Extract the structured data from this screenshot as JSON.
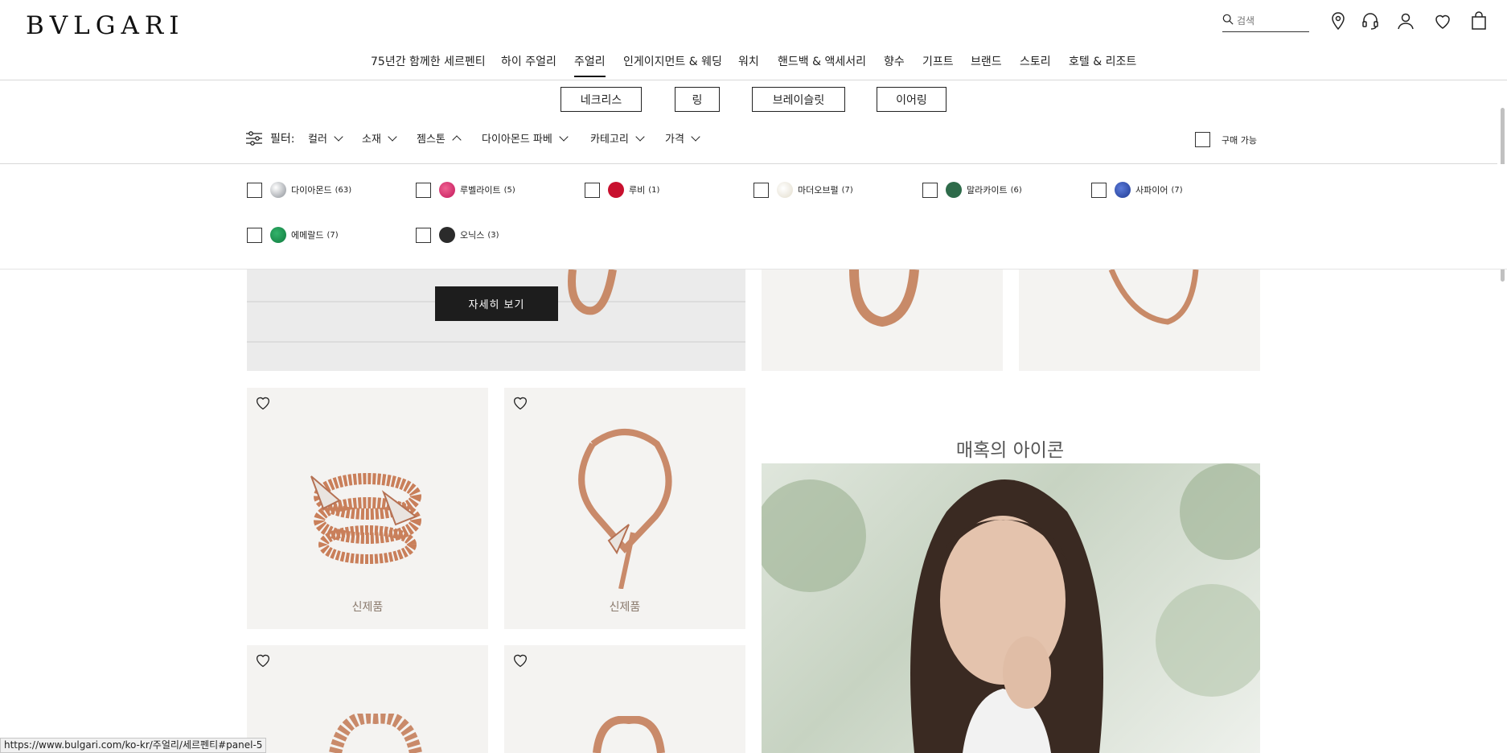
{
  "header": {
    "logo": "BVLGARI",
    "search_placeholder": "검색",
    "icons": [
      "search-icon",
      "location-pin-icon",
      "headset-icon",
      "user-icon",
      "heart-icon",
      "shopping-bag-icon"
    ]
  },
  "main_nav": [
    {
      "label": "75년간 함께한 세르펜티",
      "active": false
    },
    {
      "label": "하이 주얼리",
      "active": false
    },
    {
      "label": "주얼리",
      "active": true
    },
    {
      "label": "인게이지먼트 & 웨딩",
      "active": false
    },
    {
      "label": "워치",
      "active": false
    },
    {
      "label": "핸드백 & 액세서리",
      "active": false
    },
    {
      "label": "향수",
      "active": false
    },
    {
      "label": "기프트",
      "active": false
    },
    {
      "label": "브랜드",
      "active": false
    },
    {
      "label": "스토리",
      "active": false
    },
    {
      "label": "호텔 & 리조트",
      "active": false
    }
  ],
  "subcategories": [
    "네크리스",
    "링",
    "브레이슬릿",
    "이어링"
  ],
  "filters": {
    "label": "필터:",
    "items": [
      {
        "label": "컬러",
        "open": false
      },
      {
        "label": "소재",
        "open": false
      },
      {
        "label": "젬스톤",
        "open": true
      },
      {
        "label": "다이아몬드 파베",
        "open": false
      },
      {
        "label": "카테고리",
        "open": false
      },
      {
        "label": "가격",
        "open": false
      }
    ],
    "available_label": "구매 가능"
  },
  "gemstones": [
    {
      "label": "다이아몬드",
      "count": "(63)",
      "color": "#d6d8da"
    },
    {
      "label": "루벨라이트",
      "count": "(5)",
      "color": "#c2185b"
    },
    {
      "label": "루비",
      "count": "(1)",
      "color": "#c8102e"
    },
    {
      "label": "마더오브펄",
      "count": "(7)",
      "color": "#ece8dc"
    },
    {
      "label": "말라카이트",
      "count": "(6)",
      "color": "#2e6b4a"
    },
    {
      "label": "사파이어",
      "count": "(7)",
      "color": "#1f3a93"
    },
    {
      "label": "에메랄드",
      "count": "(7)",
      "color": "#0f7a3e"
    },
    {
      "label": "오닉스",
      "count": "(3)",
      "color": "#2b2b2b"
    }
  ],
  "hero": {
    "button_label": "자세히 보기"
  },
  "products": [
    {
      "badge": "신제품"
    },
    {
      "badge": "신제품"
    }
  ],
  "promo": {
    "title": "매혹의 아이콘"
  },
  "status_url": "https://www.bulgari.com/ko-kr/주얼리/세르펜티#panel-5"
}
